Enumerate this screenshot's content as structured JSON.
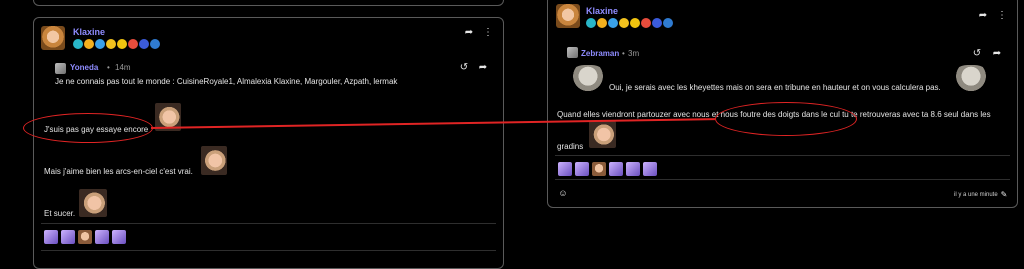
{
  "left_post": {
    "author": "Klaxine",
    "reply": {
      "author": "Yoneda",
      "separator": "•",
      "time": "14m",
      "text": "Je ne connais pas tout le monde : CuisineRoyale1, Almalexia Klaxine, Margouler, Azpath, lermak"
    },
    "lines": [
      "J'suis pas gay essaye encore",
      "Mais j'aime bien les arcs-en-ciel c'est vrai.",
      "Et sucer."
    ]
  },
  "right_post": {
    "author": "Klaxine",
    "reply": {
      "author": "Zebraman",
      "separator": "•",
      "time": "3m",
      "line1": "Oui, je serais avec les kheyettes mais on sera en tribune en hauteur et on vous calculera pas.",
      "line2": "Quand elles viendront partouzer avec nous et nous foutre des doigts dans le cul tu te retrouveras avec ta 8.6 seul dans les",
      "line3": "gradins"
    },
    "footer_time": "il y a une minute"
  },
  "icons": {
    "share": "share-arrow-icon",
    "more": "more-vertical-icon",
    "history": "history-icon",
    "edit": "pencil-icon",
    "emoji": "emoji-add-icon"
  },
  "colors": {
    "accent": "#8f8cff",
    "annotation": "#e02424",
    "badges": [
      "#29b6c8",
      "#f2b01e",
      "#3aa1e8",
      "#f2c21e",
      "#f1c40f",
      "#e74c3c",
      "#3b5bdb",
      "#2f7bd1"
    ]
  }
}
